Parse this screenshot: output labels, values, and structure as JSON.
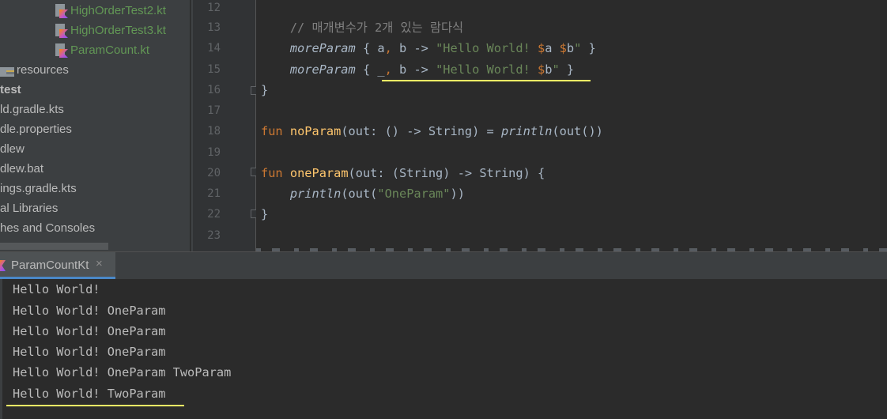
{
  "project_tree": {
    "items": [
      {
        "label": "HighOrderTest2.kt",
        "kind": "kotlin-file"
      },
      {
        "label": "HighOrderTest3.kt",
        "kind": "kotlin-file"
      },
      {
        "label": "ParamCount.kt",
        "kind": "kotlin-file"
      },
      {
        "label": "resources",
        "kind": "folder"
      },
      {
        "label": "test",
        "kind": "folder"
      },
      {
        "label": "ld.gradle.kts",
        "kind": "file"
      },
      {
        "label": "dle.properties",
        "kind": "file"
      },
      {
        "label": "dlew",
        "kind": "file"
      },
      {
        "label": "dlew.bat",
        "kind": "file"
      },
      {
        "label": "ings.gradle.kts",
        "kind": "file"
      },
      {
        "label": "al Libraries",
        "kind": "node"
      },
      {
        "label": "hes and Consoles",
        "kind": "node"
      }
    ]
  },
  "editor": {
    "line_numbers": [
      "12",
      "13",
      "14",
      "15",
      "16",
      "17",
      "18",
      "19",
      "20",
      "21",
      "22",
      "23"
    ],
    "code": {
      "l13_comment": "// 매개변수가 2개 있는 람다식",
      "l14_call": "moreParam",
      "l14_open": " { ",
      "l14_p1": "a",
      "l14_sep": ", ",
      "l14_p2": "b",
      "l14_arrow": " -> ",
      "l14_str1": "\"Hello World! ",
      "l14_d1": "$",
      "l14_v1": "a",
      "l14_sp": " ",
      "l14_d2": "$",
      "l14_v2": "b",
      "l14_str2": "\"",
      "l14_close": " }",
      "l15_call": "moreParam",
      "l15_open": " { ",
      "l15_p1": "_",
      "l15_sep": ", ",
      "l15_p2": "b",
      "l15_arrow": " -> ",
      "l15_str1": "\"Hello World! ",
      "l15_d1": "$",
      "l15_v1": "b",
      "l15_str2": "\"",
      "l15_close": " }",
      "l16": "}",
      "l18_kw": "fun",
      "l18_name": "noParam",
      "l18_rest1": "(out: () -> String) = ",
      "l18_println": "println",
      "l18_rest2": "(out())",
      "l20_kw": "fun",
      "l20_name": "oneParam",
      "l20_rest": "(out: (String) -> String) {",
      "l21_println": "println",
      "l21_rest1": "(out(",
      "l21_str": "\"OneParam\"",
      "l21_rest2": "))",
      "l22": "}"
    }
  },
  "run_panel": {
    "tab_label": "ParamCountKt",
    "close_glyph": "×",
    "output_lines": [
      "Hello World!",
      "Hello World! OneParam",
      "Hello World! OneParam",
      "Hello World! OneParam",
      "Hello World! OneParam TwoParam",
      "Hello World! TwoParam"
    ]
  },
  "colors": {
    "highlight_underline": "#ffff66",
    "keyword": "#cc7832",
    "function_name": "#ffc66d",
    "string": "#6a8759",
    "kotlin_file": "#629755"
  }
}
